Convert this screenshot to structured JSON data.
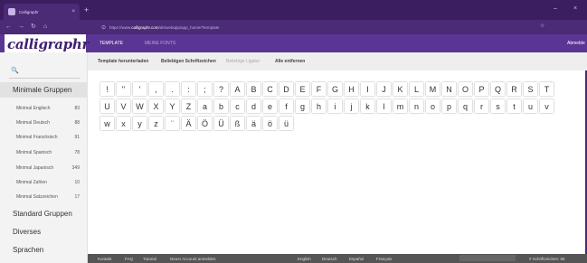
{
  "colors": {
    "brand_purple": "#5b3593",
    "brand_dark": "#3a1e60",
    "sidebar_bg": "#f3f3f3",
    "footer_bg": "#555555"
  },
  "browser": {
    "tab_title": "Calligraphr",
    "tab_close": "×",
    "new_tab": "+",
    "win_min": "–",
    "win_close": "×",
    "back": "←",
    "forward": "→",
    "reload": "↻",
    "home": "⌂",
    "url_prefix": "https://www.",
    "url_host": "calligraphr.com",
    "url_path": "/de/webapp/app_home/?template",
    "omni_end": "☆"
  },
  "header": {
    "logo": "calligraphr",
    "tabs": [
      "TEMPLATE",
      "MEINE FONTS"
    ],
    "user": "Abmelde"
  },
  "toolbar": {
    "items": [
      "Template herunterladen",
      "Beliebigen Schriftzeichen",
      "Beliebige Ligatur",
      "Alle entfernen"
    ]
  },
  "sidebar": {
    "search_icon": "search-icon",
    "search_glyph": "🔍",
    "active_group": "Minimale Gruppen",
    "items": [
      {
        "label": "Minimal Englisch",
        "count": "83"
      },
      {
        "label": "Minimal Deutsch",
        "count": "88"
      },
      {
        "label": "Minimal Französisch",
        "count": "91"
      },
      {
        "label": "Minimal Spanisch",
        "count": "78"
      },
      {
        "label": "Minimal Japanisch",
        "count": "349"
      },
      {
        "label": "Minimal Zahlen",
        "count": "10"
      },
      {
        "label": "Minimal Satzzeichen",
        "count": "17"
      }
    ],
    "sections": [
      "Standard Gruppen",
      "Diverses",
      "Sprachen"
    ]
  },
  "characters": {
    "row1": [
      "!",
      "\"",
      "'",
      ",",
      ".",
      ":",
      ";",
      "?",
      "A",
      "B",
      "C",
      "D",
      "E",
      "F",
      "G",
      "H",
      "I",
      "J",
      "K",
      "L",
      "M",
      "N",
      "O",
      "P",
      "Q",
      "R",
      "S",
      "T"
    ],
    "row2": [
      "U",
      "V",
      "W",
      "X",
      "Y",
      "Z",
      "a",
      "b",
      "c",
      "d",
      "e",
      "f",
      "g",
      "h",
      "i",
      "j",
      "k",
      "l",
      "m",
      "n",
      "o",
      "p",
      "q",
      "r",
      "s",
      "t",
      "u",
      "v"
    ],
    "row3": [
      "w",
      "x",
      "y",
      "z",
      "¨",
      "Ä",
      "Ö",
      "Ü",
      "ß",
      "ä",
      "ö",
      "ü"
    ]
  },
  "footer": {
    "links": [
      "Kontakt",
      "FAQ",
      "Tutorial",
      "Neuer Account anmelden"
    ],
    "languages": [
      "English",
      "Deutsch",
      "Español",
      "Français"
    ],
    "count_label": "# Schriftzeichen: 68"
  }
}
